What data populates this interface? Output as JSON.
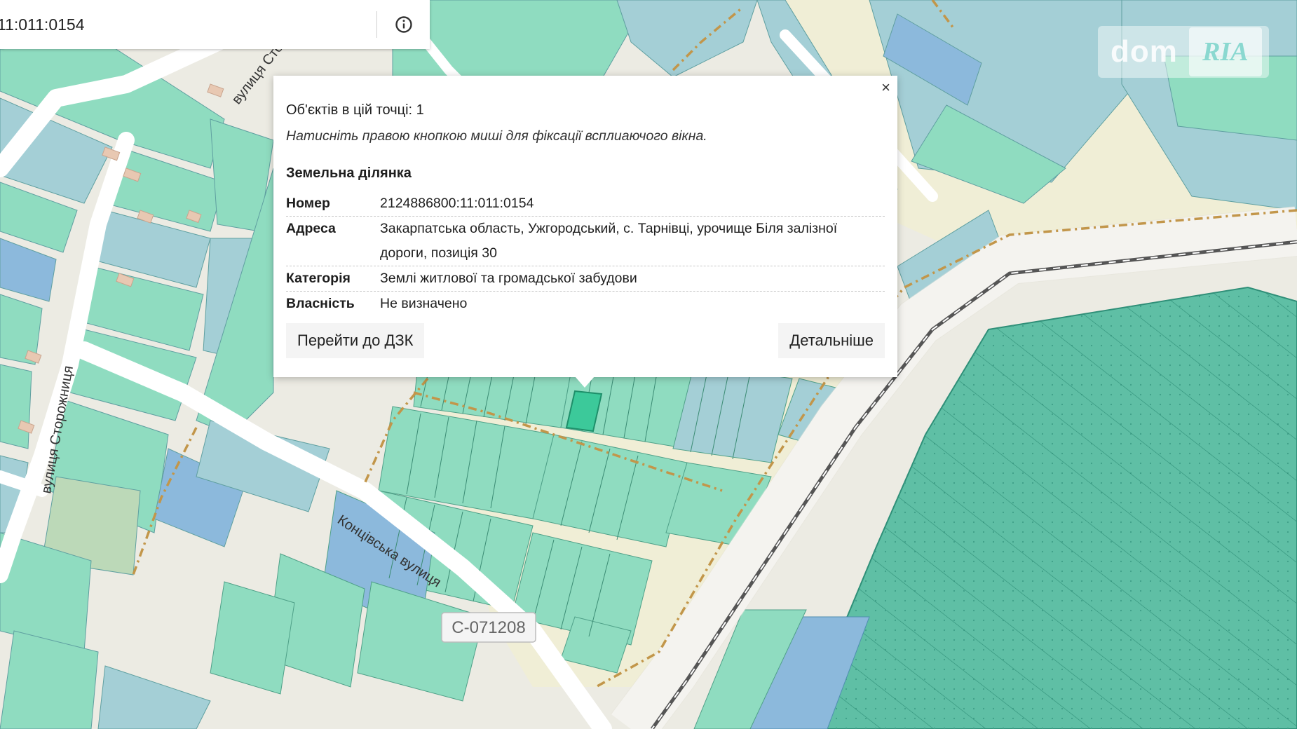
{
  "search": {
    "value": "11:011:0154"
  },
  "popup": {
    "close_label": "×",
    "count_text": "Об'єктів в цій точці: 1",
    "hint_text": "Натисніть правою кнопкою миші для фіксації всплиаючого вікна.",
    "heading": "Земельна ділянка",
    "properties": [
      {
        "key": "Номер",
        "value": "2124886800:11:011:0154"
      },
      {
        "key": "Адреса",
        "value": "Закарпатська область, Ужгородський, с. Тарнівці, урочище Біля залізної дороги, позиція 30"
      },
      {
        "key": "Категорія",
        "value": "Землі житлової та громадської забудови"
      },
      {
        "key": "Власність",
        "value": "Не визначено"
      }
    ],
    "btn_dzk": "Перейти до ДЗК",
    "btn_details": "Детальніше"
  },
  "map": {
    "street_labels": [
      "вулиця Сторожниця",
      "вулиця Сторожниця",
      "Концівська вулиця"
    ],
    "road_badge": "С-071208",
    "colors": {
      "background": "#ecebe3",
      "parcel_green": "#8fdcc0",
      "parcel_teal": "#a4cfd6",
      "parcel_blue": "#8cb9dc",
      "parcel_selected": "#3cc99a",
      "field": "#5fbfa5",
      "road": "#ffffff",
      "boundary": "#c2964a",
      "railway": "#555555"
    }
  },
  "watermark": {
    "left": "dom",
    "right": "RIA"
  }
}
